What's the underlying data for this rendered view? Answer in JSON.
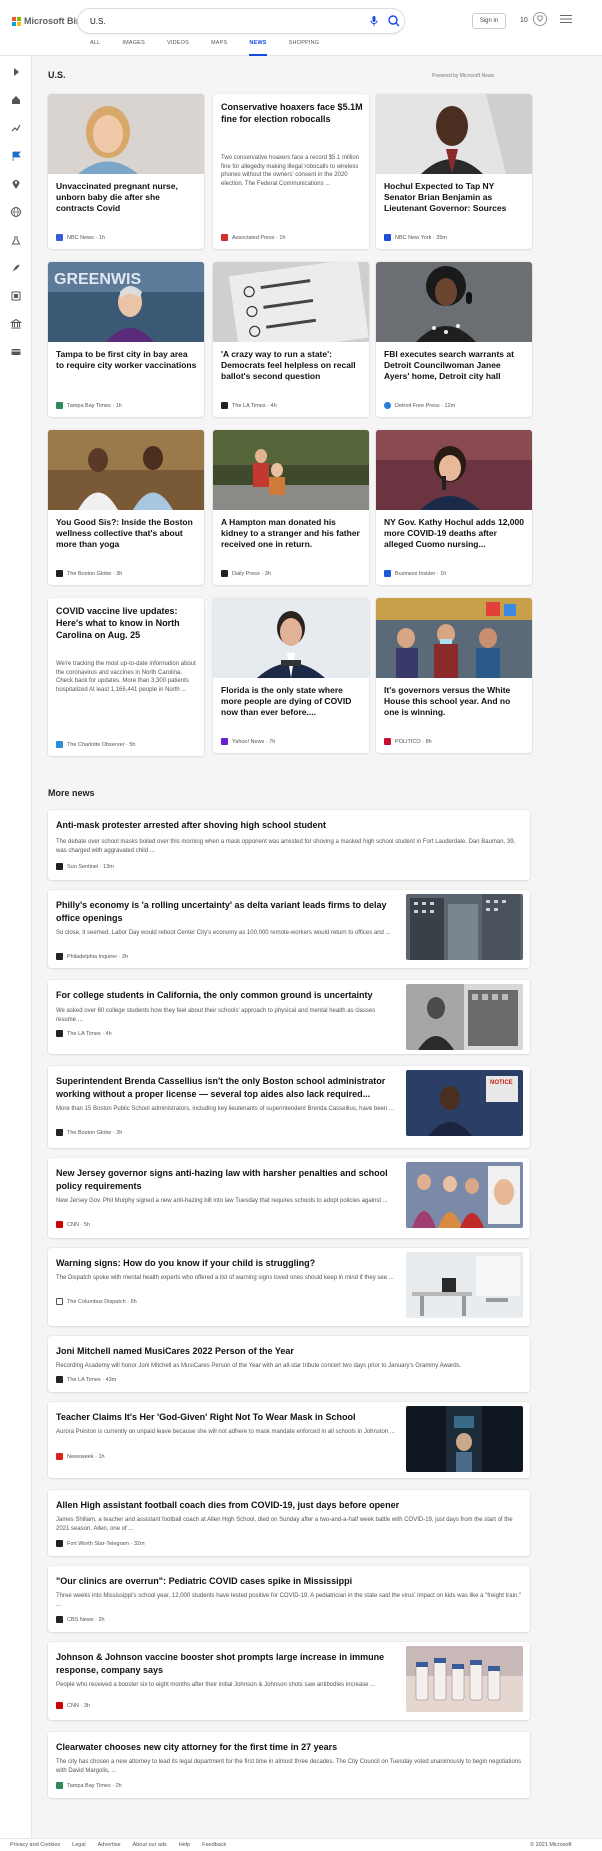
{
  "header": {
    "brand": "Microsoft Bing",
    "query": "U.S.",
    "signin_label": "Sign in",
    "rewards_count": "10",
    "brand_colors": [
      "#f35325",
      "#81bc06",
      "#05a6f0",
      "#ffba08"
    ]
  },
  "tabs": [
    "ALL",
    "IMAGES",
    "VIDEOS",
    "MAPS",
    "NEWS",
    "SHOPPING"
  ],
  "active_tab": "NEWS",
  "rail_icons": [
    "expand-icon",
    "home-icon",
    "trending-icon",
    "flag-icon",
    "location-icon",
    "globe-icon",
    "science-icon",
    "rocket-icon",
    "entertainment-icon",
    "politics-icon",
    "money-icon"
  ],
  "main": {
    "section_title": "U.S.",
    "powered_by": "Powered by Microsoft News",
    "more_news_title": "More news"
  },
  "cards": [
    {
      "headline": "Unvaccinated pregnant nurse, unborn baby die after she contracts Covid",
      "source": "NBC News",
      "time": "1h",
      "badge_color": "#3b5bdb"
    },
    {
      "headline": "Conservative hoaxers face $5.1M fine for election robocalls",
      "snippet": "Two conservative hoaxers face a record $5.1 million fine for allegedly making illegal robocalls to wireless phones without the owners' consent in the 2020 election. The Federal Communications ...",
      "source": "Associated Press",
      "time": "1h",
      "badge_color": "#d32f2f"
    },
    {
      "headline": "Hochul Expected to Tap NY Senator Brian Benjamin as Lieutenant Governor: Sources",
      "source": "NBC New York",
      "time": "35m",
      "badge_color": "#1e4fd9"
    },
    {
      "headline": "Tampa to be first city in bay area to require city worker vaccinations",
      "source": "Tampa Bay Times",
      "time": "1h",
      "badge_color": "#2e8b57"
    },
    {
      "headline": "'A crazy way to run a state': Democrats feel helpless on recall ballot's second question",
      "source": "The LA Times",
      "time": "4h",
      "badge_color": "#222222"
    },
    {
      "headline": "FBI executes search warrants at Detroit Councilwoman Janee Ayers' home, Detroit city hall",
      "source": "Detroit Free Press",
      "time": "12m",
      "badge_color": "#2a7bd4"
    },
    {
      "headline": "You Good Sis?: Inside the Boston wellness collective that's about more than yoga",
      "source": "The Boston Globe",
      "time": "3h",
      "badge_color": "#222222"
    },
    {
      "headline": "A Hampton man donated his kidney to a stranger and his father received one in return.",
      "source": "Daily Press",
      "time": "3h",
      "badge_color": "#222222"
    },
    {
      "headline": "NY Gov. Kathy Hochul adds 12,000 more COVID-19 deaths after alleged Cuomo nursing...",
      "source": "Business Insider",
      "time": "1h",
      "badge_color": "#1e5bd9"
    },
    {
      "headline": "COVID vaccine live updates: Here's what to know in North Carolina on Aug. 25",
      "snippet": "We're tracking the most up-to-date information about the coronavirus and vaccines in North Carolina. Check back for updates. More than 3,300 patients hospitalized At least 1,166,441 people in North ...",
      "source": "The Charlotte Observer",
      "time": "5h",
      "badge_color": "#2a8fd6"
    },
    {
      "headline": "Florida is the only state where more people are dying of COVID now than ever before....",
      "source": "Yahoo! News",
      "time": "7h",
      "badge_color": "#6b1fd1"
    },
    {
      "headline": "It's governors versus the White House this school year. And no one is winning.",
      "source": "POLITICO",
      "time": "8h",
      "badge_color": "#c8102e"
    }
  ],
  "more_news": [
    {
      "title": "Anti-mask protester arrested after shoving high school student",
      "desc": "The debate over school masks boiled over this morning when a mask opponent was arrested for shoving a masked high school student in Fort Lauderdale. Dan Bauman, 39, was charged with aggravated child ...",
      "source": "Sun Sentinel",
      "time": "13m",
      "badge_color": "#222222"
    },
    {
      "title": "Philly's economy is 'a rolling uncertainty' as delta variant leads firms to delay office openings",
      "desc": "So close, it seemed. Labor Day would reboot Center City's economy as 100,000 remote-workers would return to offices and ...",
      "source": "Philadelphia Inquirer",
      "time": "2h",
      "badge_color": "#222222"
    },
    {
      "title": "For college students in California, the only common ground is uncertainty",
      "desc": "We asked over 60 college students how they feel about their schools' approach to physical and mental health as classes resume ...",
      "source": "The LA Times",
      "time": "4h",
      "badge_color": "#222222"
    },
    {
      "title": "Superintendent Brenda Cassellius isn't the only Boston school administrator working without a proper license — several top aides also lack required...",
      "desc": "More than 15 Boston Public School administrators, including key lieutenants of superintendent Brenda Cassellius, have been ...",
      "source": "The Boston Globe",
      "time": "2h",
      "badge_color": "#222222"
    },
    {
      "title": "New Jersey governor signs anti-hazing law with harsher penalties and school policy requirements",
      "desc": "New Jersey Gov. Phil Murphy signed a new anti-hazing bill into law Tuesday that requires schools to adopt policies against ...",
      "source": "CNN",
      "time": "5h",
      "badge_color": "#cc0000"
    },
    {
      "title": "Warning signs: How do you know if your child is struggling?",
      "desc": "The Dispatch spoke with mental health experts who offered a list of warning signs loved ones should keep in mind if they see ...",
      "source": "The Columbus Dispatch",
      "time": "6h",
      "badge_color": "#ffffff"
    },
    {
      "title": "Joni Mitchell named MusiCares 2022 Person of the Year",
      "desc": "Recording Academy will honor Joni Mitchell as MusiCares Person of the Year with an all-star tribute concert two days prior to January's Grammy Awards.",
      "source": "The LA Times",
      "time": "43m",
      "badge_color": "#222222"
    },
    {
      "title": "Teacher Claims It's Her 'God-Given' Right Not To Wear Mask in School",
      "desc": "Aurora Preston is currently on unpaid leave because she will not adhere to mask mandate enforced in all schools in Johnston ...",
      "source": "Newsweek",
      "time": "1h",
      "badge_color": "#e0201b"
    },
    {
      "title": "Allen High assistant football coach dies from COVID-19, just days before opener",
      "desc": "James Shillam, a teacher and assistant football coach at Allen High School, died on Sunday after a two-and-a-half week battle with COVID-19, just days from the start of the 2021 season. Allen, one of ...",
      "source": "Fort Worth Star-Telegram",
      "time": "32m",
      "badge_color": "#222222"
    },
    {
      "title": "\"Our clinics are overrun\": Pediatric COVID cases spike in Mississippi",
      "desc": "Three weeks into Mississippi's school year, 12,000 students have tested positive for COVID-19. A pediatrician in the state said the virus' impact on kids was like a \"freight train.\" ...",
      "source": "CBS News",
      "time": "2h",
      "badge_color": "#222222"
    },
    {
      "title": "Johnson & Johnson vaccine booster shot prompts large increase in immune response, company says",
      "desc": "People who received a booster six to eight months after their initial Johnson & Johnson shots saw antibodies increase ...",
      "source": "CNN",
      "time": "3h",
      "badge_color": "#cc0000"
    },
    {
      "title": "Clearwater chooses new city attorney for the first time in 27 years",
      "desc": "The city has chosen a new attorney to lead its legal department for the first time in almost three decades. The City Council on Tuesday voted unanimously to begin negotiations with David Margolis, ...",
      "source": "Tampa Bay Times",
      "time": "2h",
      "badge_color": "#2e8b57"
    }
  ],
  "footer": {
    "links": [
      "Privacy and Cookies",
      "Legal",
      "Advertise",
      "About our ads",
      "Help",
      "Feedback"
    ],
    "copyright": "© 2021 Microsoft"
  }
}
